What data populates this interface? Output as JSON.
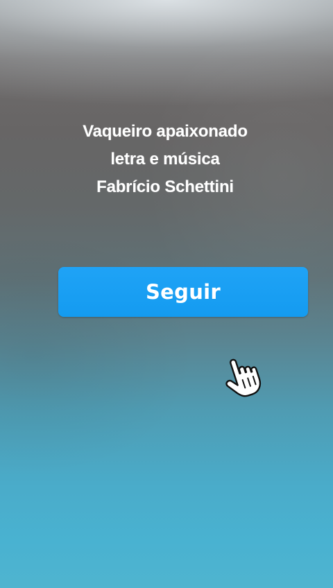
{
  "title": {
    "lines": [
      "Vaqueiro apaixonado",
      "letra e música",
      "Fabrício Schettini"
    ]
  },
  "follow_button": {
    "label": "Seguir",
    "color": "#1a9ff4"
  },
  "cursor": {
    "icon": "hand-pointer-icon"
  },
  "colors": {
    "text": "#ffffff",
    "background_top": "#6f6c6c",
    "background_bottom": "#49b2d1"
  }
}
